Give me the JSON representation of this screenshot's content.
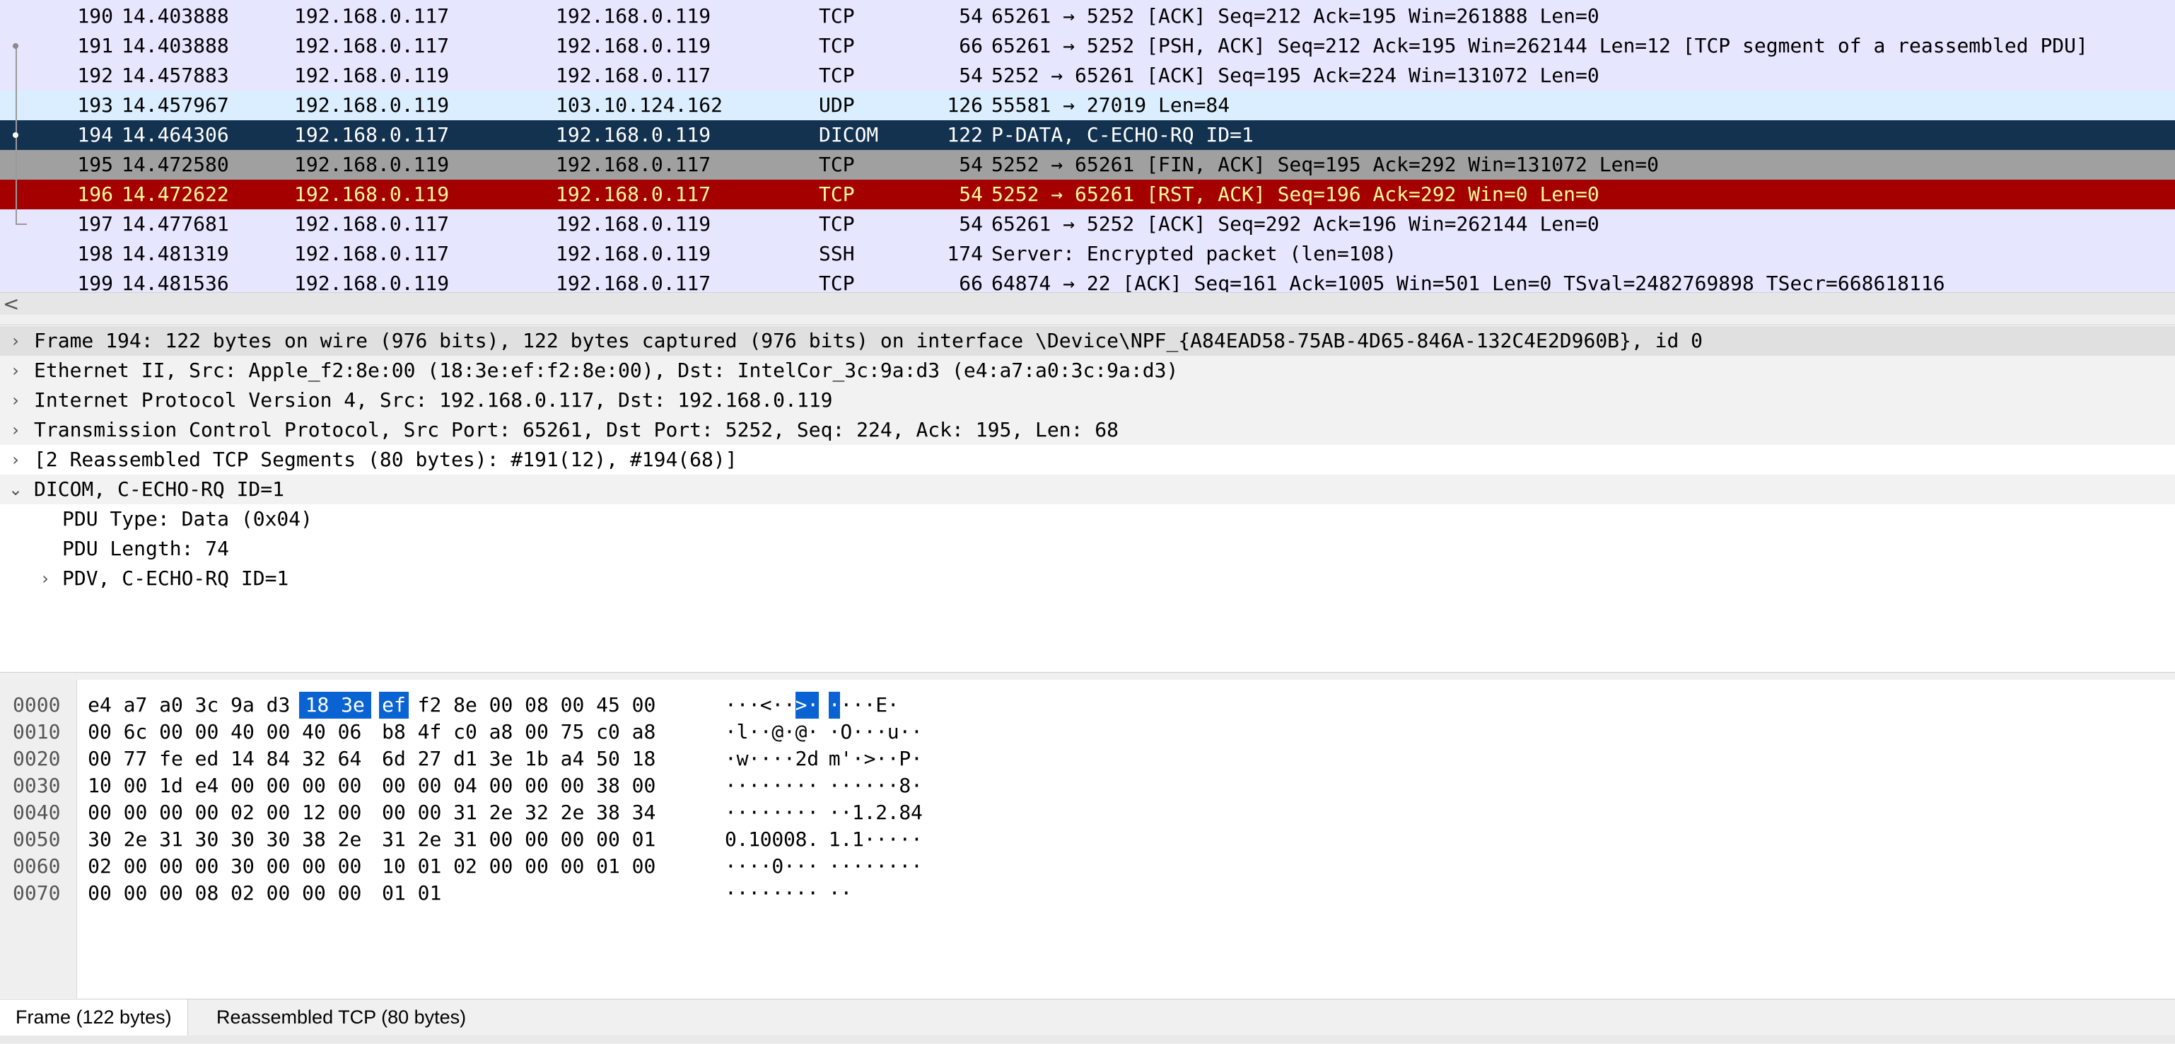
{
  "packets": [
    {
      "no": "190",
      "time": "14.403888",
      "src": "192.168.0.117",
      "dst": "192.168.0.119",
      "proto": "TCP",
      "len": "54",
      "info": "65261 → 5252 [ACK] Seq=212 Ack=195 Win=261888 Len=0",
      "bg": "#e7e6ff",
      "fg": "#000000"
    },
    {
      "no": "191",
      "time": "14.403888",
      "src": "192.168.0.117",
      "dst": "192.168.0.119",
      "proto": "TCP",
      "len": "66",
      "info": "65261 → 5252 [PSH, ACK] Seq=212 Ack=195 Win=262144 Len=12 [TCP segment of a reassembled PDU]",
      "bg": "#e7e6ff",
      "fg": "#000000"
    },
    {
      "no": "192",
      "time": "14.457883",
      "src": "192.168.0.119",
      "dst": "192.168.0.117",
      "proto": "TCP",
      "len": "54",
      "info": "5252 → 65261 [ACK] Seq=195 Ack=224 Win=131072 Len=0",
      "bg": "#e7e6ff",
      "fg": "#000000"
    },
    {
      "no": "193",
      "time": "14.457967",
      "src": "192.168.0.119",
      "dst": "103.10.124.162",
      "proto": "UDP",
      "len": "126",
      "info": "55581 → 27019 Len=84",
      "bg": "#daeeff",
      "fg": "#000000"
    },
    {
      "no": "194",
      "time": "14.464306",
      "src": "192.168.0.117",
      "dst": "192.168.0.119",
      "proto": "DICOM",
      "len": "122",
      "info": "P-DATA, C-ECHO-RQ ID=1",
      "bg": "#13324f",
      "fg": "#ffffff"
    },
    {
      "no": "195",
      "time": "14.472580",
      "src": "192.168.0.119",
      "dst": "192.168.0.117",
      "proto": "TCP",
      "len": "54",
      "info": "5252 → 65261 [FIN, ACK] Seq=195 Ack=292 Win=131072 Len=0",
      "bg": "#a0a0a0",
      "fg": "#000000"
    },
    {
      "no": "196",
      "time": "14.472622",
      "src": "192.168.0.119",
      "dst": "192.168.0.117",
      "proto": "TCP",
      "len": "54",
      "info": "5252 → 65261 [RST, ACK] Seq=196 Ack=292 Win=0 Len=0",
      "bg": "#a40000",
      "fg": "#fffc9c"
    },
    {
      "no": "197",
      "time": "14.477681",
      "src": "192.168.0.117",
      "dst": "192.168.0.119",
      "proto": "TCP",
      "len": "54",
      "info": "65261 → 5252 [ACK] Seq=292 Ack=196 Win=262144 Len=0",
      "bg": "#e7e6ff",
      "fg": "#000000"
    },
    {
      "no": "198",
      "time": "14.481319",
      "src": "192.168.0.117",
      "dst": "192.168.0.119",
      "proto": "SSH",
      "len": "174",
      "info": "Server: Encrypted packet (len=108)",
      "bg": "#e7e6ff",
      "fg": "#000000"
    },
    {
      "no": "199",
      "time": "14.481536",
      "src": "192.168.0.119",
      "dst": "192.168.0.117",
      "proto": "TCP",
      "len": "66",
      "info": "64874 → 22 [ACK] Seq=161 Ack=1005 Win=501 Len=0 TSval=2482769898 TSecr=668618116",
      "bg": "#e7e6ff",
      "fg": "#000000"
    }
  ],
  "details": [
    {
      "text": "Frame 194: 122 bytes on wire (976 bits), 122 bytes captured (976 bits) on interface \\Device\\NPF_{A84EAD58-75AB-4D65-846A-132C4E2D960B}, id 0",
      "arrow": "›",
      "bg": "#e0e0e0"
    },
    {
      "text": "Ethernet II, Src: Apple_f2:8e:00 (18:3e:ef:f2:8e:00), Dst: IntelCor_3c:9a:d3 (e4:a7:a0:3c:9a:d3)",
      "arrow": "›",
      "bg": "#f2f2f2"
    },
    {
      "text": "Internet Protocol Version 4, Src: 192.168.0.117, Dst: 192.168.0.119",
      "arrow": "›",
      "bg": "#f2f2f2"
    },
    {
      "text": "Transmission Control Protocol, Src Port: 65261, Dst Port: 5252, Seq: 224, Ack: 195, Len: 68",
      "arrow": "›",
      "bg": "#f2f2f2"
    },
    {
      "text": "[2 Reassembled TCP Segments (80 bytes): #191(12), #194(68)]",
      "arrow": "›",
      "bg": "#ffffff"
    },
    {
      "text": "DICOM, C-ECHO-RQ ID=1",
      "arrow": "⌄",
      "bg": "#f2f2f2"
    },
    {
      "text": "PDU Type: Data (0x04)",
      "arrow": "",
      "bg": "#ffffff"
    },
    {
      "text": "PDU Length: 74",
      "arrow": "",
      "bg": "#ffffff"
    },
    {
      "text": "PDV, C-ECHO-RQ ID=1",
      "arrow": "›",
      "bg": "#ffffff"
    }
  ],
  "hex": [
    {
      "offset": "0000",
      "bytes": [
        "e4",
        "a7",
        "a0",
        "3c",
        "9a",
        "d3",
        "18",
        "3e",
        "ef",
        "f2",
        "8e",
        "00",
        "08",
        "00",
        "45",
        "00"
      ],
      "ascii": "···<··>·····E·"
    },
    {
      "offset": "0010",
      "bytes": [
        "00",
        "6c",
        "00",
        "00",
        "40",
        "00",
        "40",
        "06",
        "b8",
        "4f",
        "c0",
        "a8",
        "00",
        "75",
        "c0",
        "a8"
      ],
      "ascii": "·l··@·@··O···u··"
    },
    {
      "offset": "0020",
      "bytes": [
        "00",
        "77",
        "fe",
        "ed",
        "14",
        "84",
        "32",
        "64",
        "6d",
        "27",
        "d1",
        "3e",
        "1b",
        "a4",
        "50",
        "18"
      ],
      "ascii": "·w····2dm'·>··P·"
    },
    {
      "offset": "0030",
      "bytes": [
        "10",
        "00",
        "1d",
        "e4",
        "00",
        "00",
        "00",
        "00",
        "00",
        "00",
        "04",
        "00",
        "00",
        "00",
        "38",
        "00"
      ],
      "ascii": "··············8·"
    },
    {
      "offset": "0040",
      "bytes": [
        "00",
        "00",
        "00",
        "00",
        "02",
        "00",
        "12",
        "00",
        "00",
        "00",
        "31",
        "2e",
        "32",
        "2e",
        "38",
        "34"
      ],
      "ascii": "··········1.2.84"
    },
    {
      "offset": "0050",
      "bytes": [
        "30",
        "2e",
        "31",
        "30",
        "30",
        "30",
        "38",
        "2e",
        "31",
        "2e",
        "31",
        "00",
        "00",
        "00",
        "00",
        "01"
      ],
      "ascii": "0.10008.1.1·····"
    },
    {
      "offset": "0060",
      "bytes": [
        "02",
        "00",
        "00",
        "00",
        "30",
        "00",
        "00",
        "00",
        "10",
        "01",
        "02",
        "00",
        "00",
        "00",
        "01",
        "00"
      ],
      "ascii": "····0···········"
    },
    {
      "offset": "0070",
      "bytes": [
        "00",
        "00",
        "00",
        "08",
        "02",
        "00",
        "00",
        "00",
        "01",
        "01"
      ],
      "ascii": "··········"
    }
  ],
  "hex_selected": {
    "row": 0,
    "from": 6,
    "to": 8
  },
  "tabs": {
    "frame": "Frame (122 bytes)",
    "reassembled": "Reassembled TCP (80 bytes)"
  },
  "scroll_left_glyph": "<"
}
